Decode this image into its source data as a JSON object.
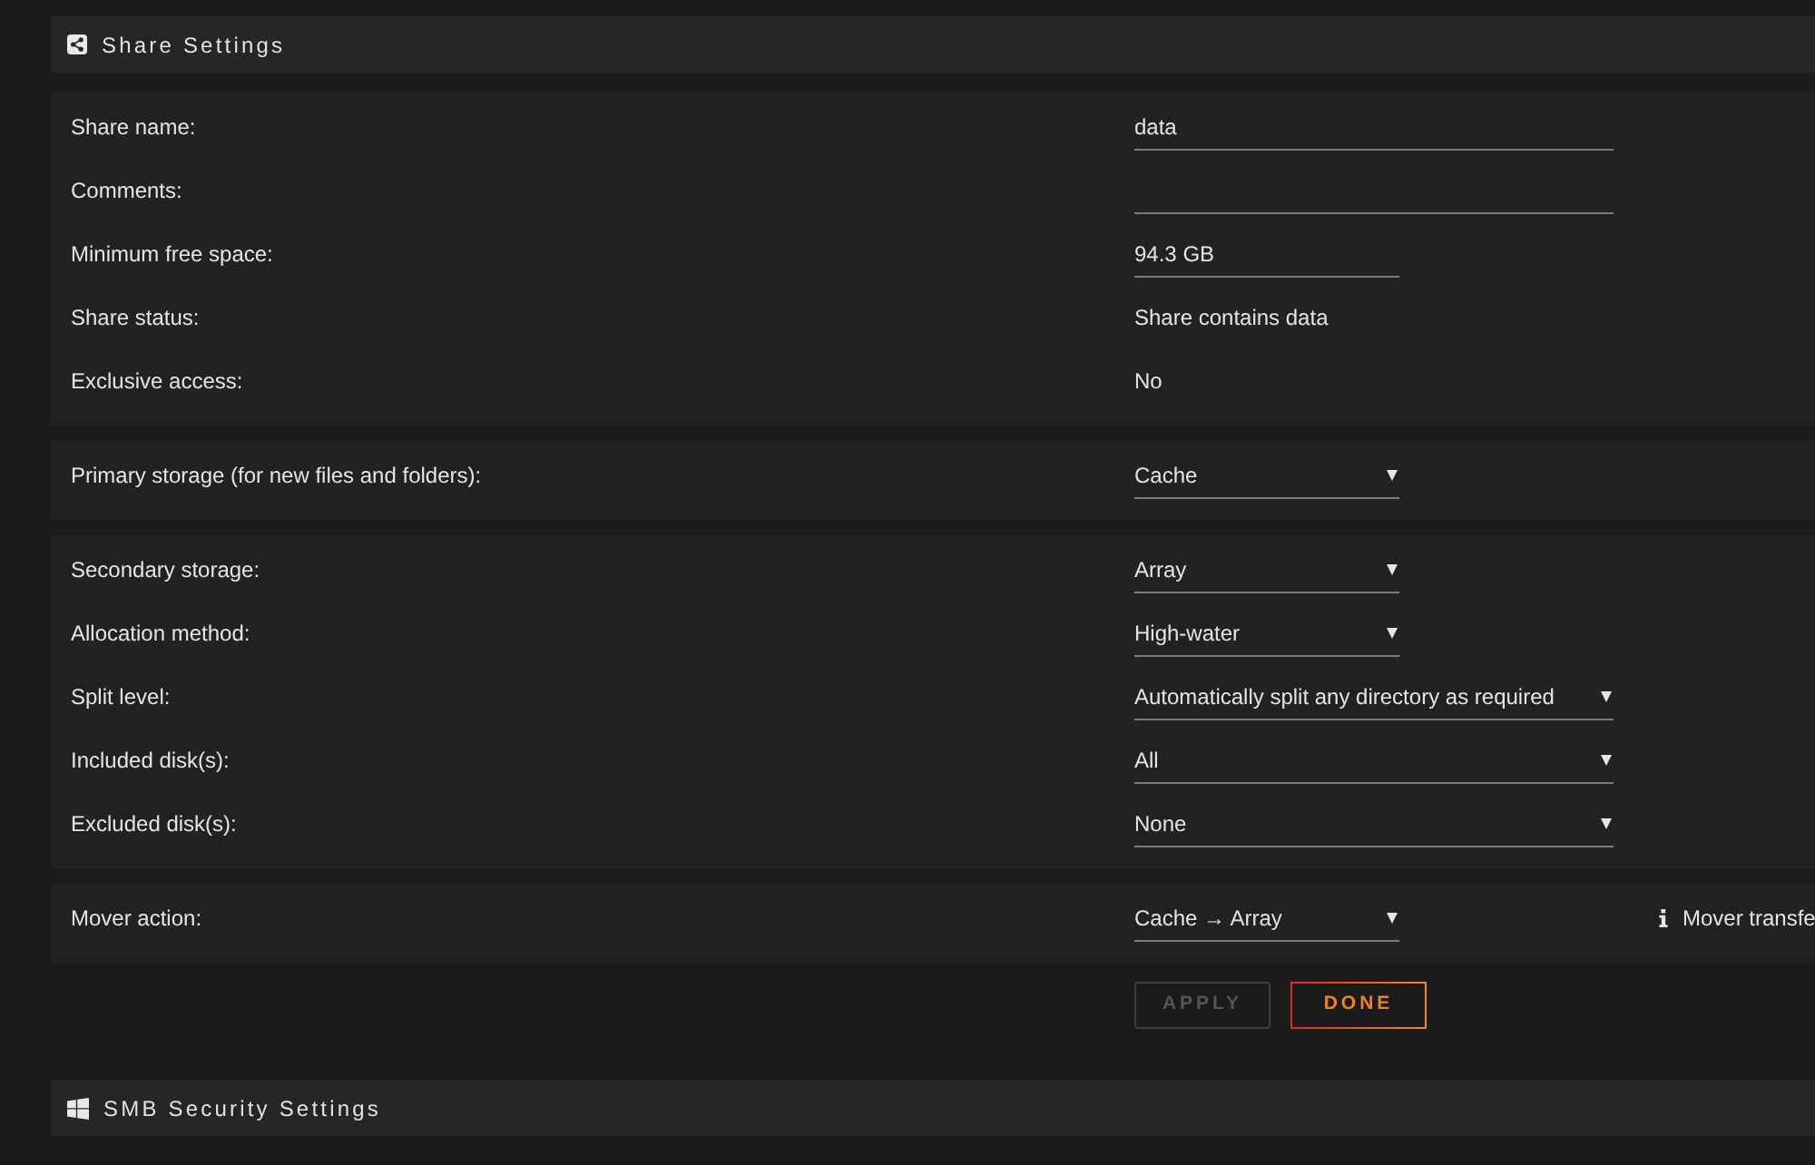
{
  "share_settings": {
    "title": "Share Settings",
    "groups": [
      {
        "rows": [
          {
            "label": "Share name:",
            "kind": "input",
            "value": "data"
          },
          {
            "label": "Comments:",
            "kind": "input"
          },
          {
            "label": "Minimum free space:",
            "kind": "input",
            "value": "94.3 GB"
          },
          {
            "label": "Share status:",
            "kind": "static",
            "value": "Share contains data"
          },
          {
            "label": "Exclusive access:",
            "kind": "static",
            "value": "No"
          }
        ]
      },
      {
        "rows": [
          {
            "label": "Primary storage (for new files and folders):",
            "kind": "select",
            "value": "Cache"
          }
        ]
      },
      {
        "rows": [
          {
            "label": "Secondary storage:",
            "kind": "select",
            "value": "Array"
          },
          {
            "label": "Allocation method:",
            "kind": "select",
            "value": "High-water"
          },
          {
            "label": "Split level:",
            "kind": "select",
            "value": "Automatically split any directory as required"
          },
          {
            "label": "Included disk(s):",
            "kind": "select",
            "value": "All"
          },
          {
            "label": "Excluded disk(s):",
            "kind": "select",
            "value": "None"
          }
        ]
      },
      {
        "rows": [
          {
            "label": "Mover action:",
            "kind": "select",
            "value": "Cache → Array",
            "note": "Mover transfe"
          }
        ]
      }
    ],
    "buttons": [
      {
        "label": "APPLY",
        "disabled": true
      },
      {
        "label": "DONE",
        "disabled": false
      }
    ]
  },
  "smb_security_settings": {
    "title": "SMB Security Settings"
  }
}
